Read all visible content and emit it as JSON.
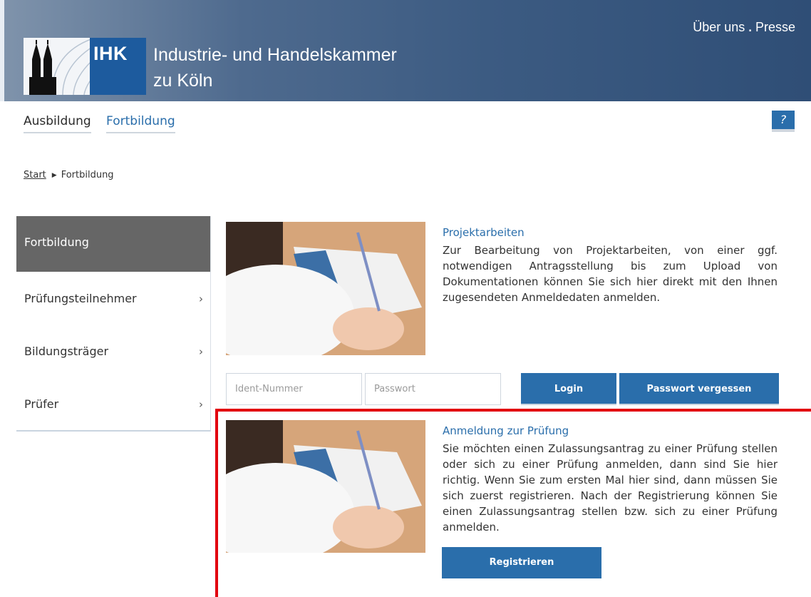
{
  "header": {
    "logo_text": "IHK",
    "org_name_line1": "Industrie- und Handelskammer",
    "org_name_line2": "zu Köln",
    "top_links": [
      {
        "label": "Über uns"
      },
      {
        "label": "Presse"
      }
    ],
    "separator": "."
  },
  "nav": {
    "items": [
      {
        "label": "Ausbildung"
      },
      {
        "label": "Fortbildung"
      }
    ],
    "active": "Fortbildung",
    "help_label": "?"
  },
  "breadcrumb": {
    "start": "Start",
    "current": "Fortbildung"
  },
  "sidebar": {
    "items": [
      {
        "label": "Fortbildung",
        "active": true
      },
      {
        "label": "Prüfungsteilnehmer",
        "chevron": "›"
      },
      {
        "label": "Bildungsträger",
        "chevron": "›"
      },
      {
        "label": "Prüfer",
        "chevron": "›"
      }
    ]
  },
  "cards": [
    {
      "title": "Projektarbeiten",
      "text": "Zur Bearbeitung von Projektarbeiten, von einer ggf. notwendigen Antragsstellung bis zum Upload von Dokumentationen können Sie sich hier direkt mit den Ihnen zugesendeten Anmeldedaten anmelden.",
      "image_icon": "exam-writing-photo"
    },
    {
      "title": "Anmeldung zur Prüfung",
      "text": "Sie möchten einen Zulassungsantrag zu einer Prüfung stellen oder sich zu einer Prüfung anmelden, dann sind Sie hier richtig. Wenn Sie zum ersten Mal hier sind, dann müssen Sie sich zuerst registrieren. Nach der Registrierung können Sie einen Zulassungsantrag stellen bzw. sich zu einer Prüfung anmelden.",
      "image_icon": "exam-writing-photo"
    }
  ],
  "login": {
    "ident_placeholder": "Ident-Nummer",
    "password_placeholder": "Passwort",
    "login_label": "Login",
    "forgot_label": "Passwort vergessen"
  },
  "register": {
    "label": "Registrieren"
  },
  "colors": {
    "primary": "#2a6eab",
    "header_dark": "#2f4e76",
    "sidebar_active": "#666666",
    "highlight": "#e2000f"
  }
}
